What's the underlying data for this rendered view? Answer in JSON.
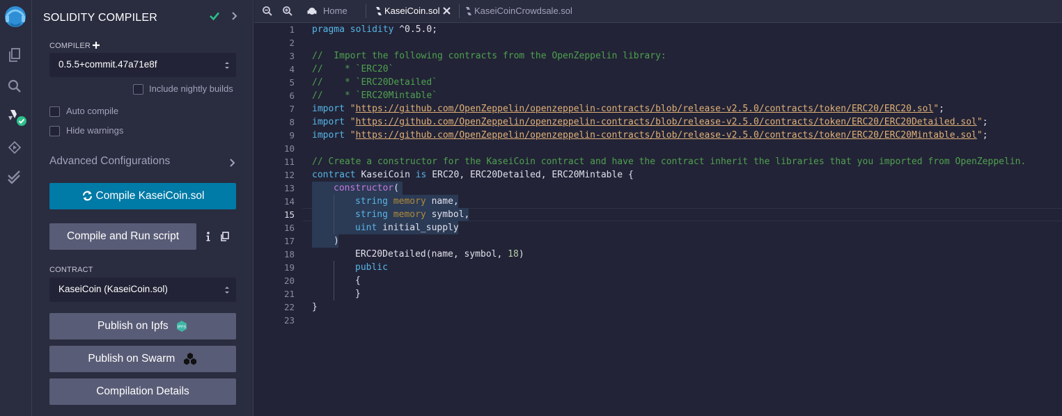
{
  "panel": {
    "title": "SOLIDITY COMPILER",
    "compiler_label": "COMPILER",
    "compiler_version": "0.5.5+commit.47a71e8f",
    "include_nightly": "Include nightly builds",
    "auto_compile": "Auto compile",
    "hide_warnings": "Hide warnings",
    "advanced": "Advanced Configurations",
    "compile_button": "Compile KaseiCoin.sol",
    "compile_run_button": "Compile and Run script",
    "contract_label": "CONTRACT",
    "contract_value": "KaseiCoin (KaseiCoin.sol)",
    "publish_ipfs": "Publish on Ipfs",
    "ipfs_badge": "IPFS",
    "publish_swarm": "Publish on Swarm",
    "compilation_details": "Compilation Details"
  },
  "tabs": [
    {
      "label": "Home"
    },
    {
      "label": "KaseiCoin.sol"
    },
    {
      "label": "KaseiCoinCrowdsale.sol"
    }
  ],
  "editor": {
    "line_numbers": [
      "1",
      "2",
      "3",
      "4",
      "5",
      "6",
      "7",
      "8",
      "9",
      "10",
      "11",
      "12",
      "13",
      "14",
      "15",
      "16",
      "17",
      "18",
      "19",
      "20",
      "21",
      "22",
      "23"
    ],
    "current_line": 15,
    "code": {
      "l1_kw": "pragma solidity",
      "l1_rest": " ^0.5.0;",
      "l3": "//  Import the following contracts from the OpenZeppelin library:",
      "l4": "//    * `ERC20`",
      "l5": "//    * `ERC20Detailed`",
      "l6": "//    * `ERC20Mintable`",
      "import_kw": "import",
      "url7": "https://github.com/OpenZeppelin/openzeppelin-contracts/blob/release-v2.5.0/contracts/token/ERC20/ERC20.sol",
      "url8": "https://github.com/OpenZeppelin/openzeppelin-contracts/blob/release-v2.5.0/contracts/token/ERC20/ERC20Detailed.sol",
      "url9": "https://github.com/OpenZeppelin/openzeppelin-contracts/blob/release-v2.5.0/contracts/token/ERC20/ERC20Mintable.sol",
      "l11": "// Create a constructor for the KaseiCoin contract and have the contract inherit the libraries that you imported from OpenZeppelin.",
      "contract_kw": "contract",
      "l12_a": " KaseiCoin ",
      "is_kw": "is",
      "l12_b": " ERC20, ERC20Detailed, ERC20Mintable {",
      "constructor": "constructor",
      "string_kw": "string",
      "memory_kw": "memory",
      "uint_kw": "uint",
      "p_name": " name,",
      "p_symbol": " symbol,",
      "p_supply": " initial_supply",
      "l18_a": "ERC20Detailed(name, symbol, ",
      "l18_num": "18",
      "l18_b": ")",
      "public_kw": "public",
      "open_brace": "{",
      "close_brace": "}",
      "close_paren": ")"
    }
  }
}
